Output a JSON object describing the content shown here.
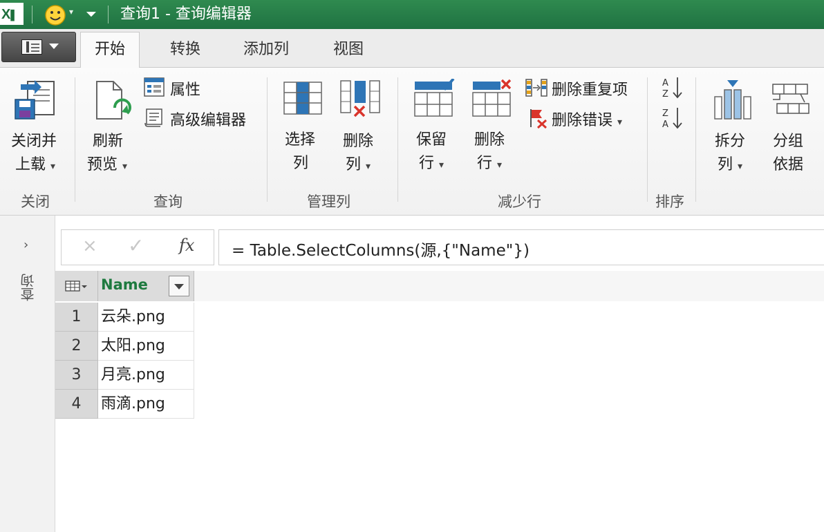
{
  "window": {
    "app_icon_text": "X",
    "title": "查询1 - 查询编辑器"
  },
  "tabs": [
    "开始",
    "转换",
    "添加列",
    "视图"
  ],
  "ribbon": {
    "close_group": {
      "button_line1": "关闭并",
      "button_line2": "上载",
      "label": "关闭"
    },
    "query_group": {
      "refresh_line1": "刷新",
      "refresh_line2": "预览",
      "properties": "属性",
      "advanced_editor": "高级编辑器",
      "label": "查询"
    },
    "manage_columns_group": {
      "choose_line1": "选择",
      "choose_line2": "列",
      "remove_line1": "删除",
      "remove_line2": "列",
      "label": "管理列"
    },
    "reduce_rows_group": {
      "keep_line1": "保留",
      "keep_line2": "行",
      "remove_line1": "删除",
      "remove_line2": "行",
      "remove_duplicates": "删除重复项",
      "remove_errors": "删除错误",
      "label": "减少行"
    },
    "sort_group": {
      "label": "排序"
    },
    "split_group": {
      "split_line1": "拆分",
      "split_line2": "列",
      "group_line1": "分组",
      "group_line2": "依据"
    }
  },
  "sidepane": {
    "expand_glyph": "›",
    "label": "查询"
  },
  "formula_bar": {
    "cancel_glyph": "×",
    "confirm_glyph": "✓",
    "fx_label": "fx",
    "formula": "= Table.SelectColumns(源,{\"Name\"})"
  },
  "table": {
    "column": "Name",
    "rows": [
      {
        "num": "1",
        "value": "云朵.png"
      },
      {
        "num": "2",
        "value": "太阳.png"
      },
      {
        "num": "3",
        "value": "月亮.png"
      },
      {
        "num": "4",
        "value": "雨滴.png"
      }
    ]
  },
  "colors": {
    "title_bar": "#217346",
    "column_header_text": "#1e7a3f",
    "ribbon_blue": "#2e75b6"
  }
}
